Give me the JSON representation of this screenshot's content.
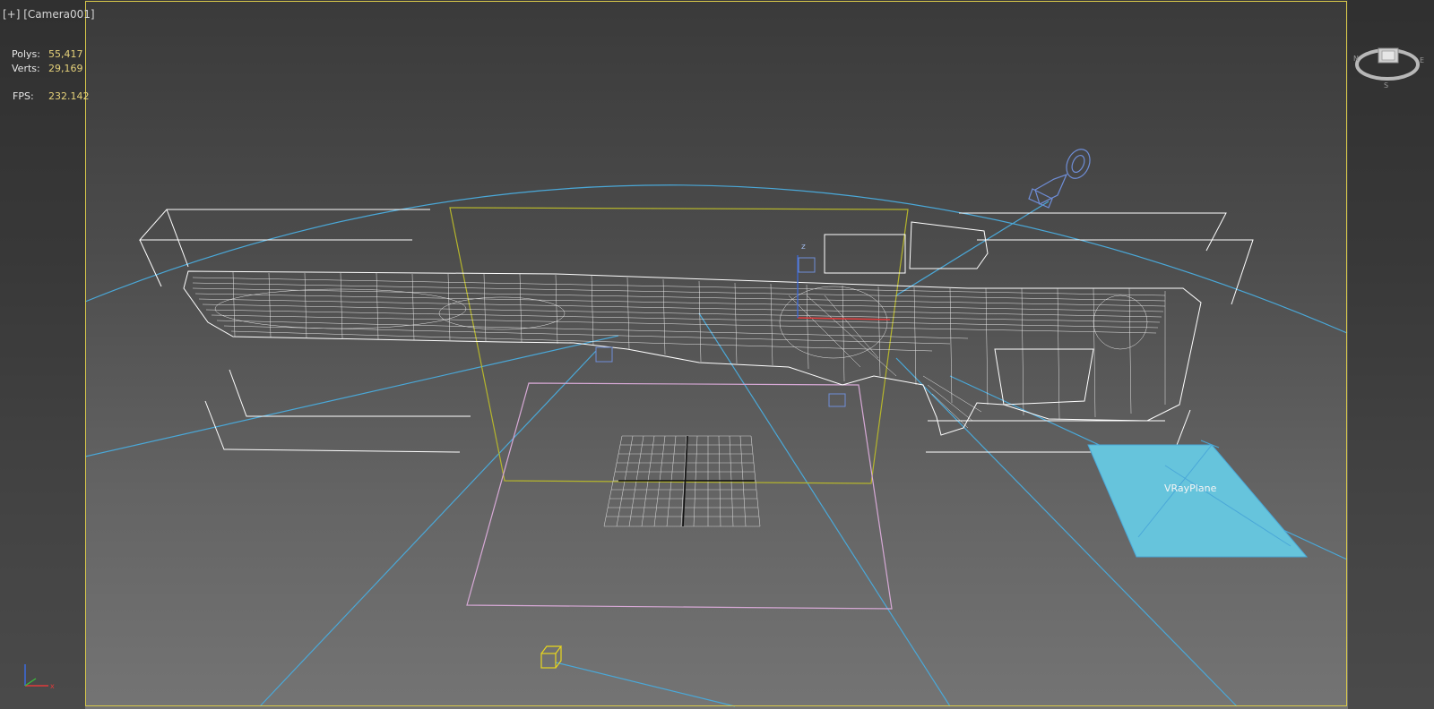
{
  "viewport": {
    "label_plus": "[+]",
    "label_camera": "[Camera001]"
  },
  "stats": {
    "polys_label": "Polys:",
    "polys_value": "55,417",
    "verts_label": "Verts:",
    "verts_value": "29,169",
    "fps_label": "FPS:",
    "fps_value": "232.142"
  },
  "scene": {
    "vray_plane_label": "VRayPlane"
  },
  "colors": {
    "stats_value": "#e6d27a",
    "safe_frame": "#d8c84a",
    "camera_lines": "#4aa8d8",
    "vray_plane": "#66c4dc",
    "wireframe": "#ffffff",
    "target_box": "#d7a9d6"
  },
  "icons": {
    "viewcube": "viewcube-icon",
    "axis_tripod": "axis-tripod-icon",
    "camera": "camera-icon",
    "light": "light-icon"
  }
}
